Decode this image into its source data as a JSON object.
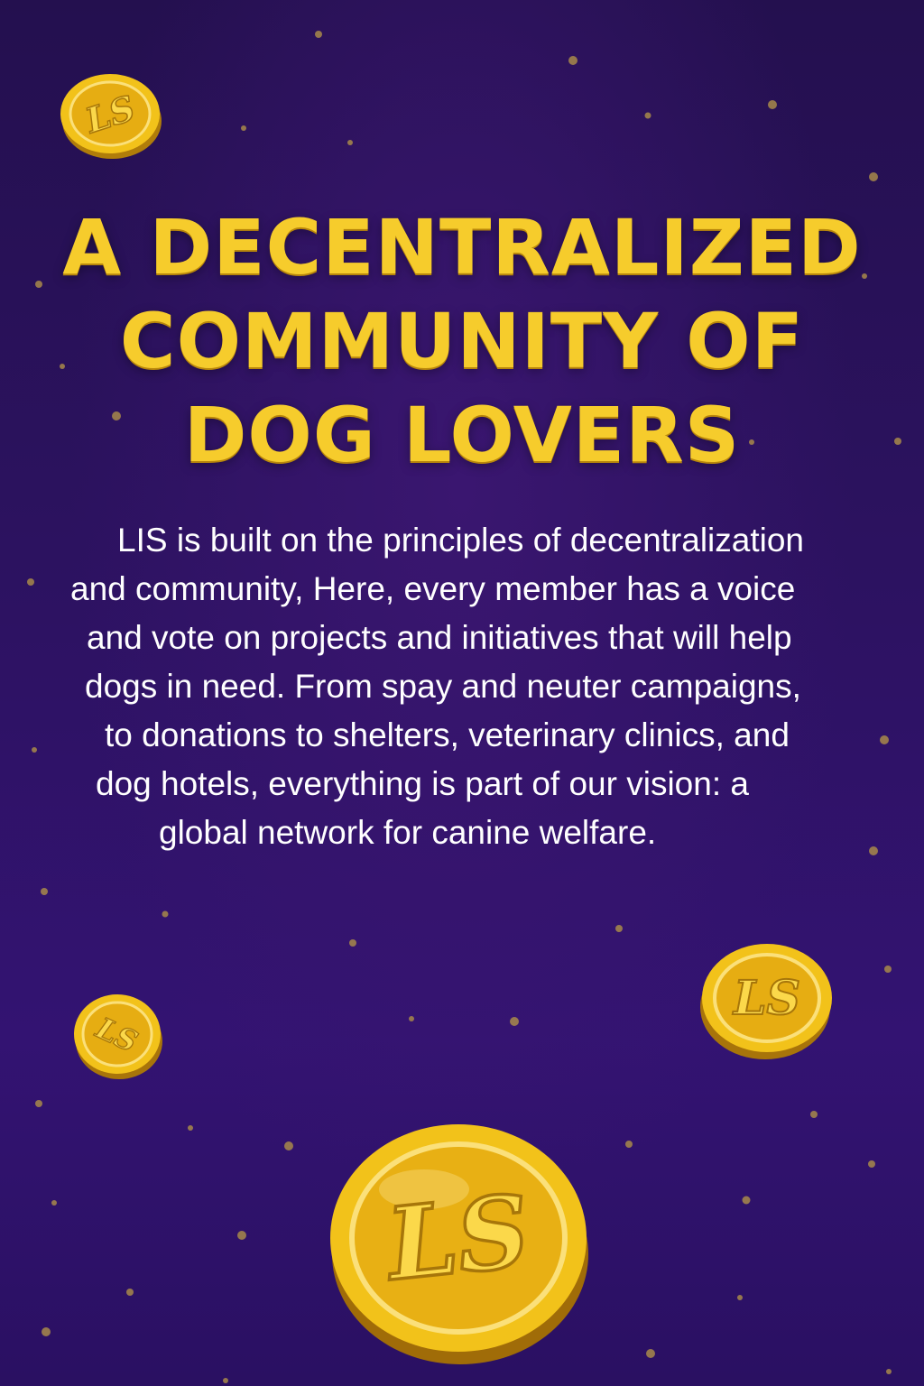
{
  "headline": {
    "line1": "A DECENTRALIZED",
    "line2": "COMMUNITY OF",
    "line3": "DOG LOVERS"
  },
  "body": {
    "lines": [
      "LIS is built on the principles of decentralization",
      "and community, Here, every member has a voice",
      "and vote on projects and initiatives that will help",
      "dogs in need. From spay and neuter campaigns,",
      "to donations to shelters, veterinary clinics, and",
      "dog hotels, everything is part of our vision: a",
      "global network for canine welfare."
    ]
  },
  "coins": {
    "label": "LS",
    "icon": "gold-coin-icon"
  },
  "colors": {
    "background_top": "#24104f",
    "background_bottom": "#331372",
    "headline": "#f6cc2c",
    "body_text": "#ffffff",
    "coin_gold": "#f2c21a",
    "sparkle": "#a8894a"
  }
}
